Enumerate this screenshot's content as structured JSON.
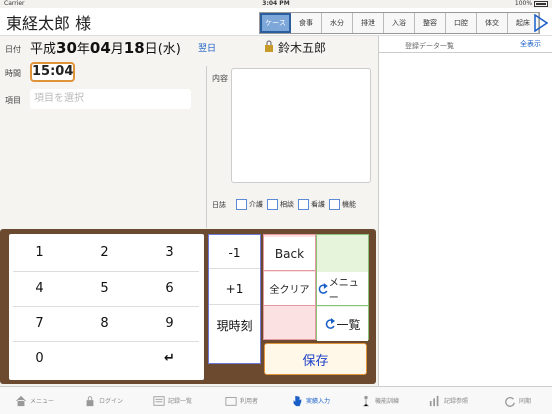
{
  "status_bar": {
    "carrier": "Carrier",
    "time": "3:04 PM",
    "battery": "100%"
  },
  "header": {
    "patient_name": "東経太郎 様",
    "tabs": [
      {
        "label": "ケース",
        "active": true
      },
      {
        "label": "食事"
      },
      {
        "label": "水分"
      },
      {
        "label": "排泄"
      },
      {
        "label": "入浴"
      },
      {
        "label": "整容"
      },
      {
        "label": "口腔"
      },
      {
        "label": "体交"
      },
      {
        "label": "起床"
      }
    ]
  },
  "form": {
    "date_label": "日付",
    "date_era": "平成",
    "date_year": "30",
    "date_y_unit": "年",
    "date_month": "04",
    "date_m_unit": "月",
    "date_day": "18",
    "date_d_unit": "日",
    "date_weekday": "(水)",
    "next_day": "翌日",
    "staff_name": "鈴木五郎",
    "time_label": "時間",
    "time_value": "15:04",
    "item_label": "項目",
    "item_placeholder": "項目を選択",
    "content_label": "内容",
    "journal_label": "日誌",
    "journal_options": [
      "介護",
      "相談",
      "看護",
      "機能"
    ]
  },
  "right_panel": {
    "title": "登録データ一覧",
    "show_all": "全表示"
  },
  "keypad": {
    "numbers": [
      "1",
      "2",
      "3",
      "4",
      "5",
      "6",
      "7",
      "8",
      "9",
      "0"
    ],
    "enter": "↵",
    "minus1": "-1",
    "plus1": "+1",
    "now": "現時刻",
    "back": "Back",
    "clear_all": "全クリア",
    "menu": "メニュー",
    "list": "一覧",
    "save": "保存"
  },
  "tab_bar": [
    {
      "label": "メニュー",
      "icon": "home-icon"
    },
    {
      "label": "ログイン",
      "icon": "lock-icon"
    },
    {
      "label": "記録一覧",
      "icon": "list-icon"
    },
    {
      "label": "利用者",
      "icon": "folder-icon"
    },
    {
      "label": "実績入力",
      "icon": "hand-icon",
      "active": true
    },
    {
      "label": "機能訓練",
      "icon": "training-icon"
    },
    {
      "label": "記録参照",
      "icon": "chart-icon"
    },
    {
      "label": "同期",
      "icon": "sync-icon"
    }
  ],
  "colors": {
    "accent": "#1a5fc8",
    "time_border": "#e0943a",
    "keypad_frame": "#6b4a30",
    "active_tab": "#7da6d9"
  }
}
